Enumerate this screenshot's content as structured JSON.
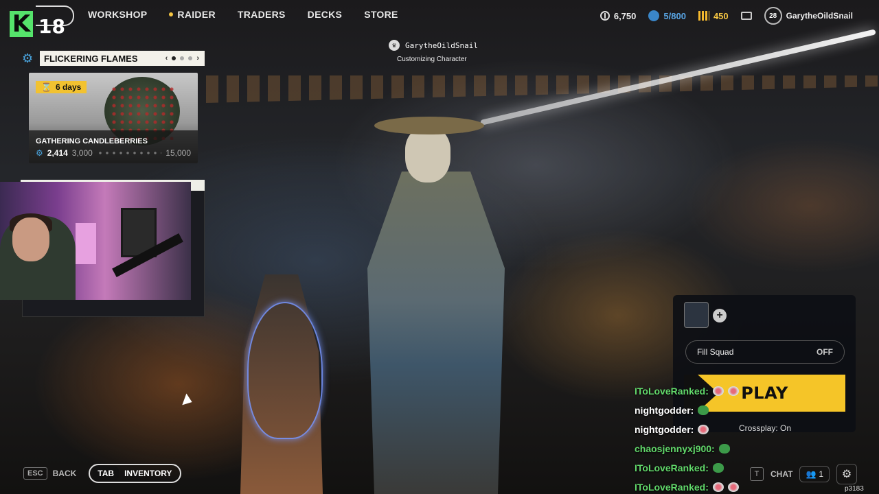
{
  "nav": {
    "level": "18",
    "items": [
      {
        "label": "WORKSHOP",
        "dot": false
      },
      {
        "label": "RAIDER",
        "dot": true
      },
      {
        "label": "TRADERS",
        "dot": false
      },
      {
        "label": "DECKS",
        "dot": false
      },
      {
        "label": "STORE",
        "dot": false
      }
    ]
  },
  "currency": {
    "coins": "6,750",
    "stash": "5/800",
    "gold": "450"
  },
  "profile": {
    "level": "28",
    "username": "GarytheOildSnail"
  },
  "event": {
    "title": "FLICKERING FLAMES",
    "prev_glyph": "‹",
    "next_glyph": "›",
    "card": {
      "days": "6 days",
      "name": "GATHERING CANDLEBERRIES",
      "current": "2,414",
      "milestone": "3,000",
      "max": "15,000"
    }
  },
  "center": {
    "username": "GarytheOildSnail",
    "status": "Customizing Character"
  },
  "squad": {
    "add_glyph": "+",
    "fill_label": "Fill Squad",
    "fill_value": "OFF",
    "play_label": "PLAY",
    "crossplay": "Crossplay: On"
  },
  "chat": [
    {
      "user": "IToLoveRanked:",
      "emotes": 2,
      "color": "green"
    },
    {
      "user": "nightgodder:",
      "emotes": 1,
      "color": "white"
    },
    {
      "user": "nightgodder:",
      "emotes": 1,
      "color": "white"
    },
    {
      "user": "chaosjennyxj900:",
      "emotes": 1,
      "color": "green"
    },
    {
      "user": "IToLoveRanked:",
      "emotes": 1,
      "color": "green"
    },
    {
      "user": "IToLoveRanked:",
      "emotes": 2,
      "color": "green"
    }
  ],
  "bottom": {
    "esc_key": "ESC",
    "back_label": "BACK",
    "tab_key": "TAB",
    "inventory_label": "INVENTORY",
    "chat_key": "T",
    "chat_label": "CHAT",
    "friends_count": "1",
    "build": "p3183"
  },
  "colors": {
    "accent_yellow": "#f5c528",
    "brand_green": "#55e36b",
    "chat_green": "#62d96b"
  },
  "icons": {
    "logo": "k-logo-icon",
    "coins": "coin-icon",
    "stash": "stash-icon",
    "gold": "gold-bars-icon",
    "mail": "mail-icon",
    "settings": "gear-icon",
    "friends": "people-icon"
  }
}
